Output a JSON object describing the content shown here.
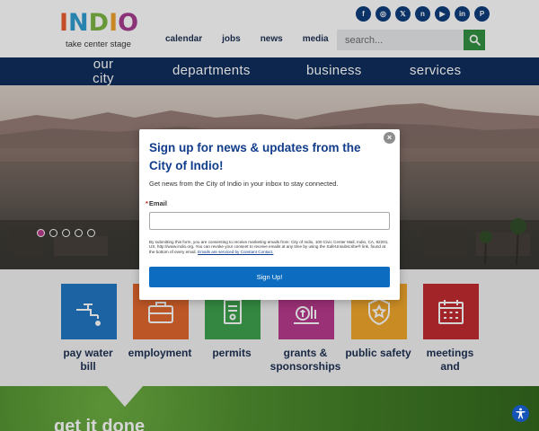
{
  "header": {
    "logo": {
      "word": [
        "I",
        "N",
        "D",
        "I",
        "O"
      ],
      "letter_colors": [
        "#e85a2a",
        "#2c9bd1",
        "#7bb441",
        "#f0a22a",
        "#a7398e"
      ],
      "tagline": "take center stage"
    },
    "topnav": [
      "calendar",
      "jobs",
      "news",
      "media"
    ],
    "social": [
      {
        "icon": "facebook-icon",
        "glyph": "f"
      },
      {
        "icon": "instagram-icon",
        "glyph": "◎"
      },
      {
        "icon": "x-twitter-icon",
        "glyph": "𝕏"
      },
      {
        "icon": "nextdoor-icon",
        "glyph": "n"
      },
      {
        "icon": "youtube-icon",
        "glyph": "▶"
      },
      {
        "icon": "linkedin-icon",
        "glyph": "in"
      },
      {
        "icon": "pinterest-icon",
        "glyph": "P"
      }
    ],
    "search": {
      "placeholder": "search...",
      "icon": "search-icon"
    }
  },
  "mainnav": {
    "our_city_line1": "our",
    "our_city_line2": "city",
    "departments": "departments",
    "business": "business",
    "services": "services"
  },
  "hero": {
    "slides": 5,
    "active_slide": 1
  },
  "tiles": [
    {
      "label_line1": "pay water",
      "label_line2": "bill",
      "color": "#1d74c2",
      "icon": "water-faucet-icon"
    },
    {
      "label_line1": "employment",
      "label_line2": "",
      "color": "#e1642a",
      "icon": "briefcase-icon"
    },
    {
      "label_line1": "permits",
      "label_line2": "",
      "color": "#3aa04a",
      "icon": "permit-document-icon"
    },
    {
      "label_line1": "grants &",
      "label_line2": "sponsorships",
      "color": "#b7368a",
      "icon": "grants-icon"
    },
    {
      "label_line1": "public safety",
      "label_line2": "",
      "color": "#f1a528",
      "icon": "police-badge-icon"
    },
    {
      "label_line1": "meetings",
      "label_line2": "and",
      "color": "#c1272d",
      "icon": "calendar-icon"
    }
  ],
  "green_band": {
    "heading": "get it done"
  },
  "modal": {
    "title": "Sign up for news & updates from the City of Indio!",
    "subtitle": "Get news from the City of Indio in your inbox to stay connected.",
    "email_required_mark": "*",
    "email_label": "Email",
    "email_value": "",
    "legal_text": "By submitting this form, you are consenting to receive marketing emails from: City of Indio, 100 Civic Center Mall, Indio, CA, 92201, US, http://www.indio.org. You can revoke your consent to receive emails at any time by using the SafeUnsubscribe® link, found at the bottom of every email.",
    "legal_link": "Emails are serviced by Constant Contact.",
    "button_label": "Sign Up!",
    "close_glyph": "×"
  },
  "accessibility": {
    "icon": "accessibility-icon"
  }
}
